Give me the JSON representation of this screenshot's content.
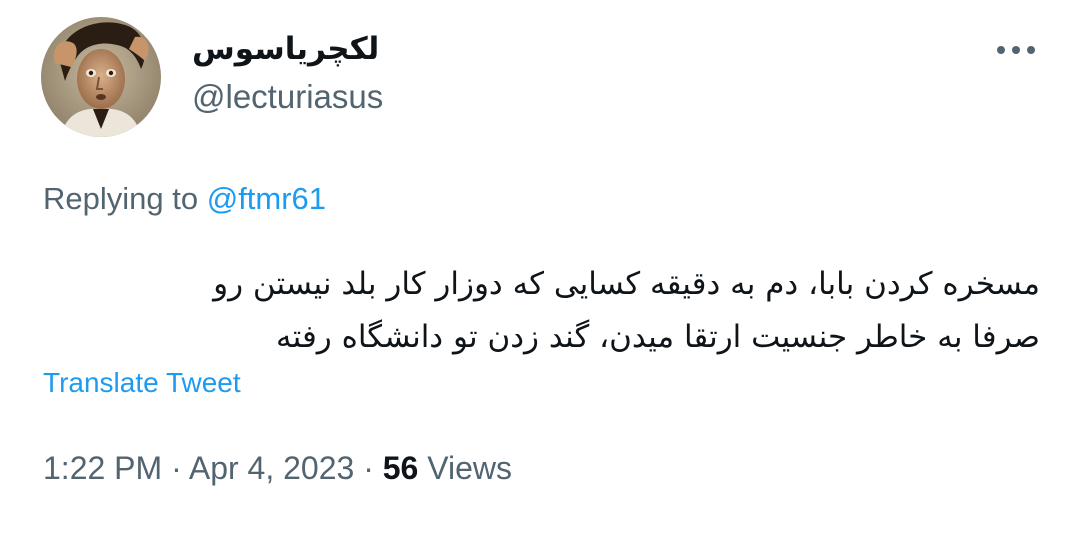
{
  "tweet": {
    "author": {
      "display_name": "لکچریاسوس",
      "handle": "@lecturiasus",
      "avatar_icon": "avatar-portrait"
    },
    "more_icon": "more-horizontal-icon",
    "replying_to_prefix": "Replying to",
    "replying_to_handle": "@ftmr61",
    "text_lines": [
      "مسخره کردن بابا، دم به دقیقه کسایی که دوزار کار بلد نیستن رو",
      "صرفا به خاطر جنسیت ارتقا میدن، گند زدن تو دانشگاه رفته"
    ],
    "translate_label": "Translate Tweet",
    "time": "1:22 PM",
    "separator": "·",
    "date": "Apr 4, 2023",
    "views_count": "56",
    "views_label": "Views"
  },
  "colors": {
    "text_primary": "#0f1419",
    "text_secondary": "#536471",
    "link_blue": "#1d9bf0"
  }
}
